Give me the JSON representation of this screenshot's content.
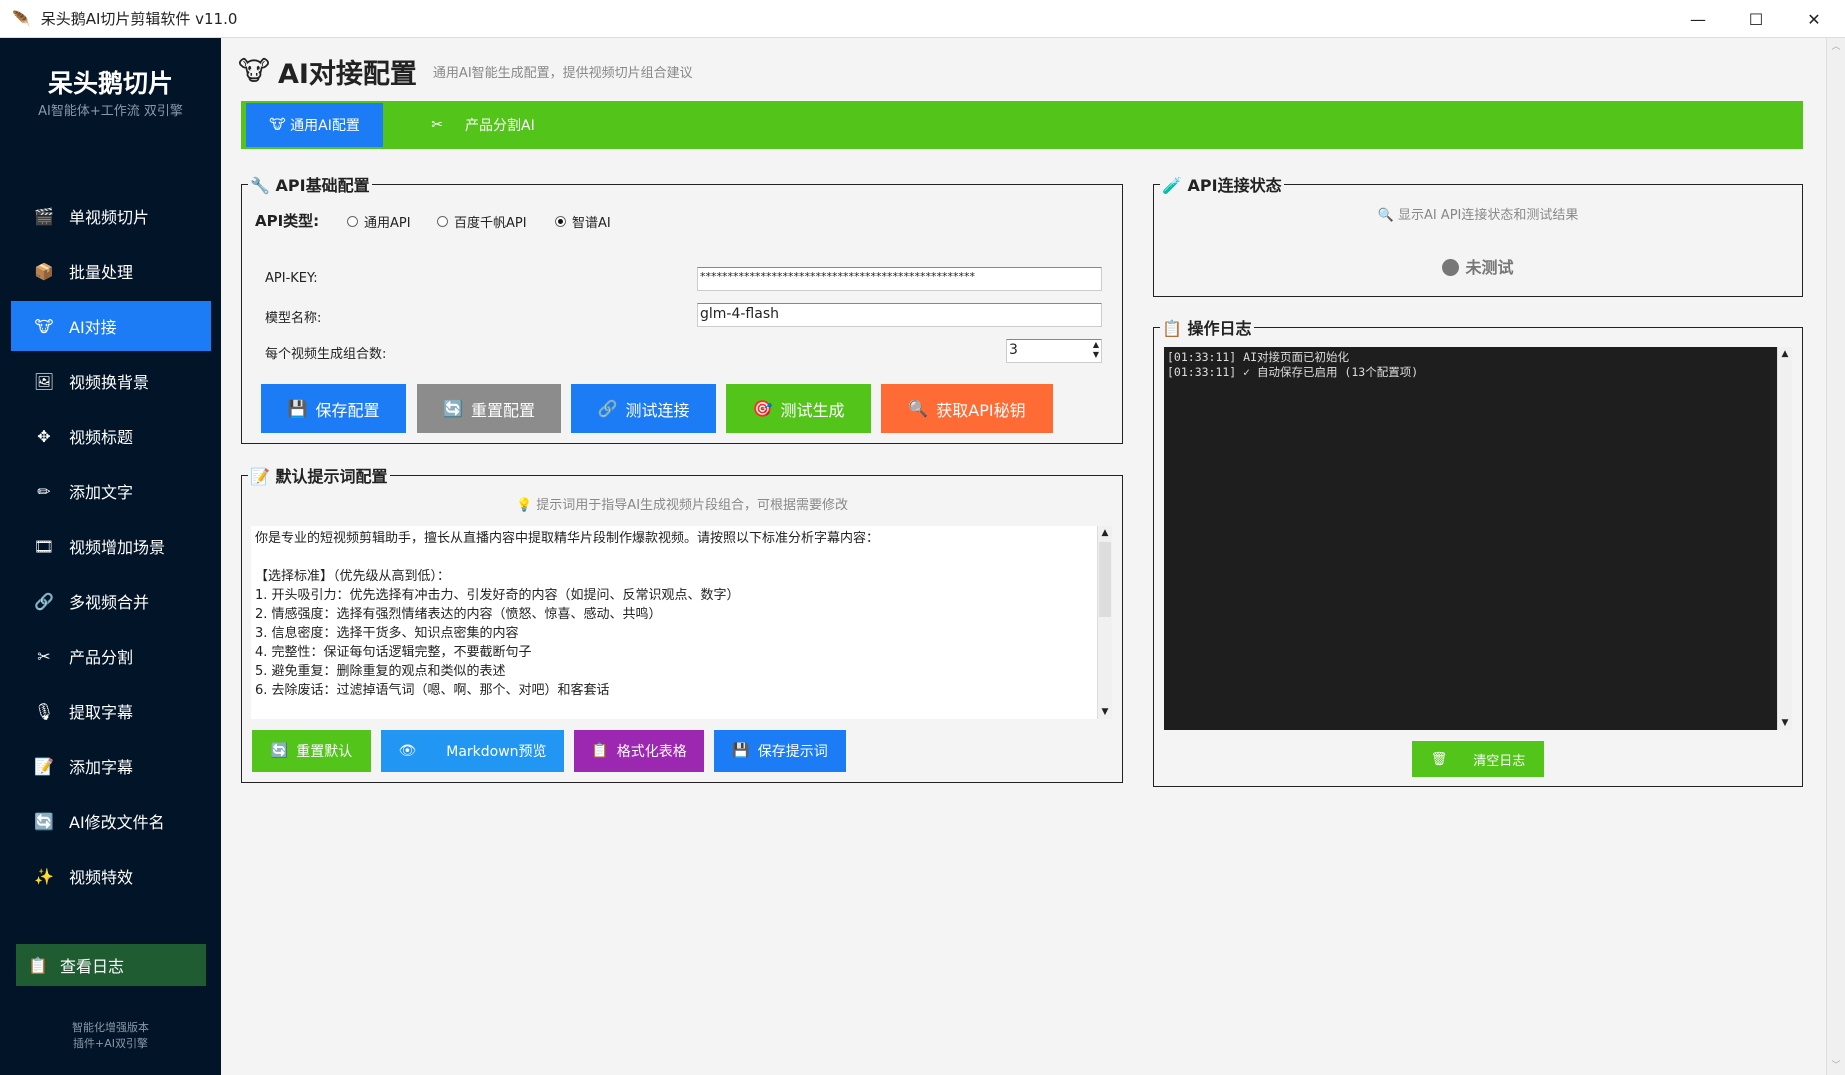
{
  "window": {
    "title": "呆头鹅AI切片剪辑软件 v11.0",
    "minimize": "—",
    "maximize": "☐",
    "close": "✕"
  },
  "sidebar": {
    "brand": "呆头鹅切片",
    "subtitle": "AI智能体+工作流 双引擎",
    "items": [
      {
        "icon": "🎬",
        "label": "单视频切片"
      },
      {
        "icon": "📦",
        "label": "批量处理"
      },
      {
        "icon": "🐮",
        "label": "AI对接"
      },
      {
        "icon": "🖼",
        "label": "视频换背景"
      },
      {
        "icon": "✥",
        "label": "视频标题"
      },
      {
        "icon": "✏",
        "label": "添加文字"
      },
      {
        "icon": "🎞",
        "label": "视频增加场景"
      },
      {
        "icon": "🔗",
        "label": "多视频合并"
      },
      {
        "icon": "✂",
        "label": "产品分割"
      },
      {
        "icon": "🎙",
        "label": "提取字幕"
      },
      {
        "icon": "📝",
        "label": "添加字幕"
      },
      {
        "icon": "🔄",
        "label": "AI修改文件名"
      },
      {
        "icon": "✨",
        "label": "视频特效"
      }
    ],
    "active_index": 2,
    "log_button": "查看日志",
    "footer1": "智能化增强版本",
    "footer2": "插件+AI双引擎"
  },
  "header": {
    "title": "AI对接配置",
    "subtitle": "通用AI智能生成配置，提供视频切片组合建议"
  },
  "tabs": [
    {
      "label": "通用AI配置",
      "active": true
    },
    {
      "label": "产品分割AI",
      "active": false
    }
  ],
  "api_config": {
    "legend": "API基础配置",
    "type_label": "API类型:",
    "types": [
      "通用API",
      "百度千帆API",
      "智谱AI"
    ],
    "selected_type": "智谱AI",
    "api_key_label": "API-KEY:",
    "api_key_value": "**************************************************",
    "model_label": "模型名称:",
    "model_value": "glm-4-flash",
    "count_label": "每个视频生成组合数:",
    "count_value": "3",
    "buttons": {
      "save": "保存配置",
      "reset": "重置配置",
      "test": "测试连接",
      "generate": "测试生成",
      "get_key": "获取API秘钥"
    }
  },
  "status": {
    "legend": "API连接状态",
    "hint": "显示AI API连接状态和测试结果",
    "state": "未测试"
  },
  "log": {
    "legend": "操作日志",
    "lines": [
      "[01:33:11] AI对接页面已初始化",
      "[01:33:11] ✓ 自动保存已启用 (13个配置项)"
    ],
    "clear": "清空日志"
  },
  "prompt": {
    "legend": "默认提示词配置",
    "hint": "提示词用于指导AI生成视频片段组合，可根据需要修改",
    "text": "你是专业的短视频剪辑助手，擅长从直播内容中提取精华片段制作爆款视频。请按照以下标准分析字幕内容：\n\n【选择标准】（优先级从高到低）：\n1. 开头吸引力：优先选择有冲击力、引发好奇的内容（如提问、反常识观点、数字）\n2. 情感强度：选择有强烈情绪表达的内容（愤怒、惊喜、感动、共鸣）\n3. 信息密度：选择干货多、知识点密集的内容\n4. 完整性：保证每句话逻辑完整，不要截断句子\n5. 避免重复：删除重复的观点和类似的表述\n6. 去除废话：过滤掉语气词（嗯、啊、那个、对吧）和客套话",
    "buttons": {
      "reset": "重置默认",
      "preview": "Markdown预览",
      "format": "格式化表格",
      "save": "保存提示词"
    }
  },
  "colors": {
    "sidebar": "#011428",
    "accent": "#1b7cf5",
    "green": "#52c41a",
    "gray": "#8c8c8c",
    "orange": "#ff6b35",
    "purple": "#9c27b0",
    "light_blue": "#2196f3"
  }
}
